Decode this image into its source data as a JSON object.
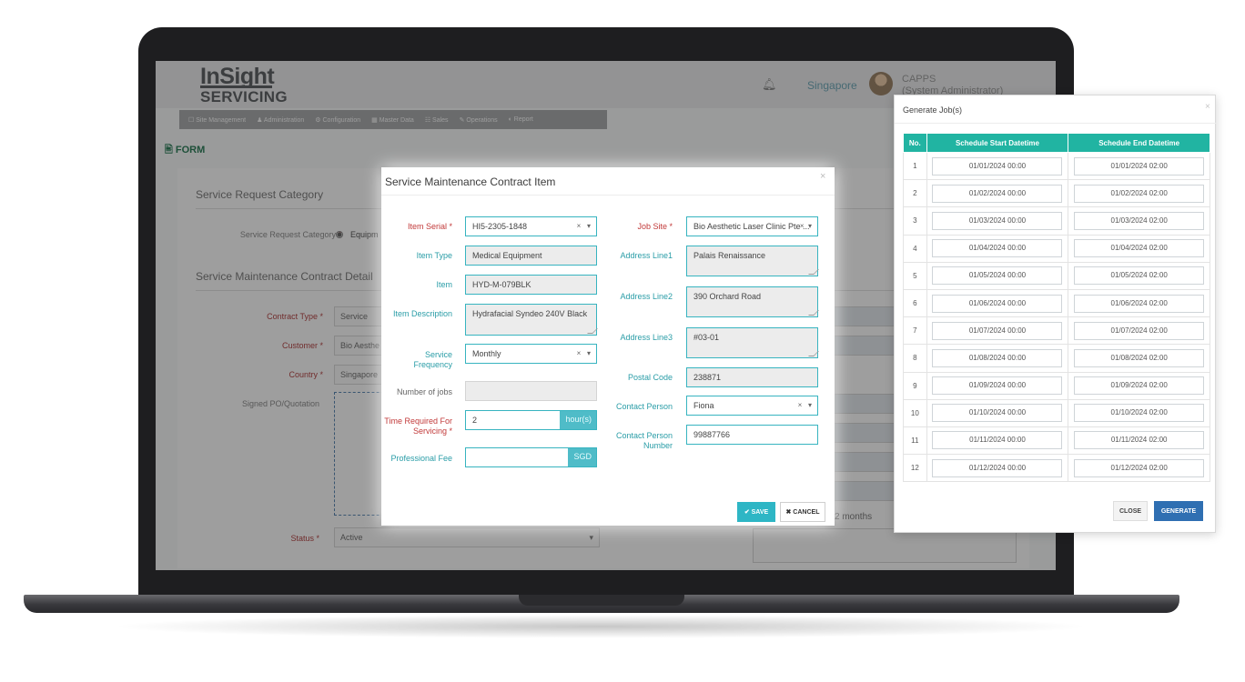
{
  "app": {
    "logo_top": "InSight",
    "logo_bottom": "SERVICING",
    "header_country": "Singapore",
    "user_name": "CAPPS",
    "user_role": "(System Administrator)",
    "nav": [
      "☐ Site Management",
      "♟ Administration",
      "⚙ Configuration",
      "▦ Master Data",
      "☷ Sales",
      "✎ Operations",
      "◐ Report"
    ]
  },
  "form": {
    "title": "FORM",
    "section_category": "Service Request Category",
    "category_label": "Service Request Category",
    "category_option": "Equipm",
    "section_contract": "Service Maintenance Contract Detail",
    "contract_type_label": "Contract Type",
    "contract_type_value": "Service",
    "customer_label": "Customer",
    "customer_value": "Bio Aesthe",
    "country_label": "Country",
    "country_value": "Singapore",
    "signed_po_label": "Signed PO/Quotation",
    "status_label": "Status",
    "status_value": "Active",
    "months_text": "2 months"
  },
  "modal": {
    "title": "Service Maintenance Contract Item",
    "item_serial_label": "Item Serial",
    "item_serial_value": "HI5-2305-1848",
    "item_type_label": "Item Type",
    "item_type_value": "Medical Equipment",
    "item_label": "Item",
    "item_value": "HYD-M-079BLK",
    "item_desc_label": "Item Description",
    "item_desc_value": "Hydrafacial Syndeo 240V Black",
    "service_freq_label_1": "Service",
    "service_freq_label_2": "Frequency",
    "service_freq_value": "Monthly",
    "num_jobs_label": "Number of jobs",
    "time_req_label_1": "Time Required For",
    "time_req_label_2": "Servicing",
    "time_req_value": "2",
    "time_req_unit": "hour(s)",
    "prof_fee_label": "Professional Fee",
    "prof_fee_unit": "SGD",
    "job_site_label": "Job Site",
    "job_site_value": "Bio Aesthetic Laser Clinic Pte ...",
    "addr1_label": "Address Line1",
    "addr1_value": "Palais Renaissance",
    "addr2_label": "Address Line2",
    "addr2_value": "390 Orchard Road",
    "addr3_label": "Address Line3",
    "addr3_value": "#03-01",
    "postal_label": "Postal Code",
    "postal_value": "238871",
    "contact_label": "Contact Person",
    "contact_value": "Fiona",
    "contact_num_label_1": "Contact Person",
    "contact_num_label_2": "Number",
    "contact_num_value": "99887766",
    "required_mark": "*",
    "clear_mark": "×",
    "caret_mark": "▾",
    "save_label": "✔ SAVE",
    "cancel_label": "✖ CANCEL",
    "close_mark": "×"
  },
  "generate": {
    "title": "Generate Job(s)",
    "close_mark": "×",
    "col_no": "No.",
    "col_start": "Schedule Start Datetime",
    "col_end": "Schedule End Datetime",
    "rows": [
      {
        "no": "1",
        "start": "01/01/2024 00:00",
        "end": "01/01/2024 02:00"
      },
      {
        "no": "2",
        "start": "01/02/2024 00:00",
        "end": "01/02/2024 02:00"
      },
      {
        "no": "3",
        "start": "01/03/2024 00:00",
        "end": "01/03/2024 02:00"
      },
      {
        "no": "4",
        "start": "01/04/2024 00:00",
        "end": "01/04/2024 02:00"
      },
      {
        "no": "5",
        "start": "01/05/2024 00:00",
        "end": "01/05/2024 02:00"
      },
      {
        "no": "6",
        "start": "01/06/2024 00:00",
        "end": "01/06/2024 02:00"
      },
      {
        "no": "7",
        "start": "01/07/2024 00:00",
        "end": "01/07/2024 02:00"
      },
      {
        "no": "8",
        "start": "01/08/2024 00:00",
        "end": "01/08/2024 02:00"
      },
      {
        "no": "9",
        "start": "01/09/2024 00:00",
        "end": "01/09/2024 02:00"
      },
      {
        "no": "10",
        "start": "01/10/2024 00:00",
        "end": "01/10/2024 02:00"
      },
      {
        "no": "11",
        "start": "01/11/2024 00:00",
        "end": "01/11/2024 02:00"
      },
      {
        "no": "12",
        "start": "01/12/2024 00:00",
        "end": "01/12/2024 02:00"
      }
    ],
    "close_label": "CLOSE",
    "generate_label": "GENERATE"
  },
  "colors": {
    "teal_accent": "#2eb6c5",
    "table_header": "#21b4a2",
    "generate_button": "#2f6fb2",
    "required_red": "#c23a3a"
  }
}
